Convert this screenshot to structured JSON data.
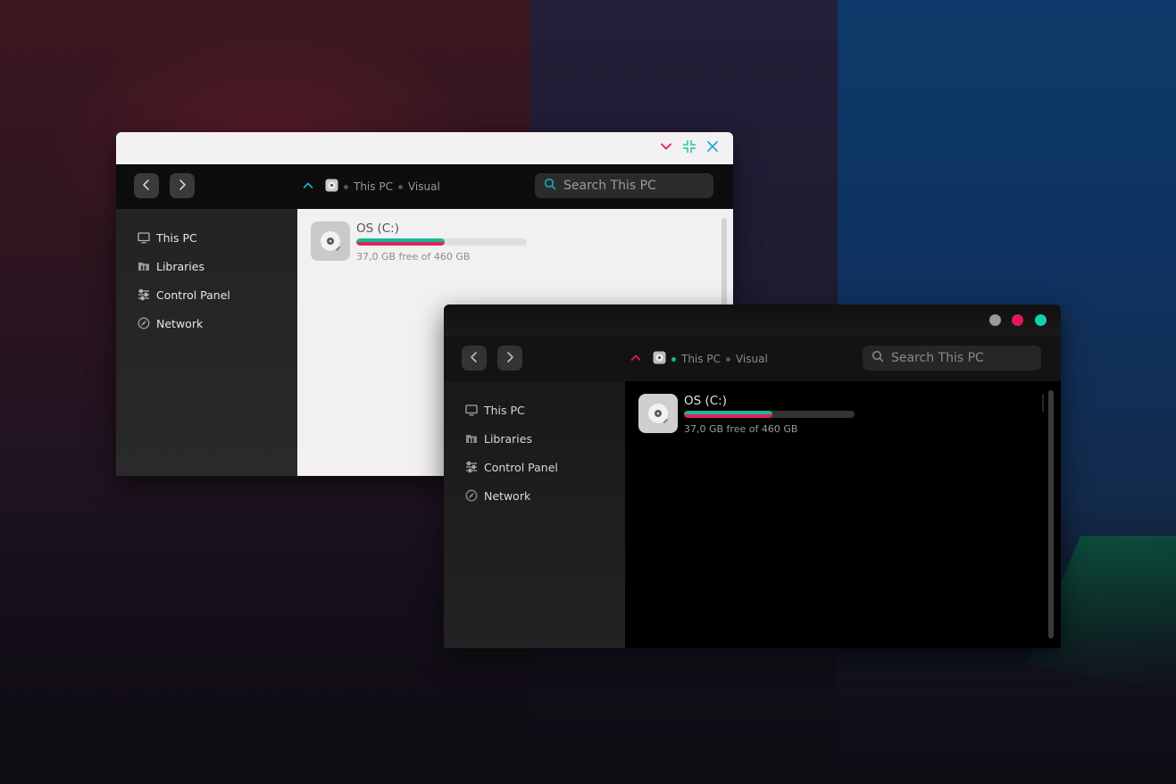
{
  "colors": {
    "accent_pink": "#e2185c",
    "accent_teal": "#14c8a8",
    "drive_fill_gradient": [
      "#14b99a",
      "#e0245e"
    ],
    "dot_gray": "#9b9b9b",
    "dot_pink": "#e2185c",
    "dot_teal": "#15d0a8"
  },
  "light_window": {
    "titlebar": {
      "buttons": [
        {
          "name": "minimize",
          "icon": "chevron-down-icon"
        },
        {
          "name": "restore",
          "icon": "compress-icon"
        },
        {
          "name": "close",
          "icon": "close-icon"
        }
      ]
    },
    "toolbar": {
      "back_icon": "chevron-left-icon",
      "forward_icon": "chevron-right-icon",
      "up_icon": "chevron-up-icon",
      "breadcrumb": [
        "This PC",
        "Visual"
      ],
      "search_placeholder": "Search This PC"
    },
    "sidebar": {
      "items": [
        {
          "label": "This PC",
          "icon": "monitor-icon"
        },
        {
          "label": "Libraries",
          "icon": "folder-icon"
        },
        {
          "label": "Control Panel",
          "icon": "sliders-icon"
        },
        {
          "label": "Network",
          "icon": "network-icon"
        }
      ]
    },
    "drive": {
      "name": "OS (C:)",
      "free_text": "37,0 GB free of 460 GB",
      "used_fraction": 0.52
    }
  },
  "dark_window": {
    "titlebar": {
      "buttons": [
        {
          "name": "minimize",
          "icon": "gray-dot-icon"
        },
        {
          "name": "maximize",
          "icon": "pink-dot-icon"
        },
        {
          "name": "close",
          "icon": "teal-dot-icon"
        }
      ]
    },
    "toolbar": {
      "back_icon": "chevron-left-icon",
      "forward_icon": "chevron-right-icon",
      "up_icon": "chevron-up-icon",
      "breadcrumb": [
        "This PC",
        "Visual"
      ],
      "search_placeholder": "Search This PC"
    },
    "sidebar": {
      "items": [
        {
          "label": "This PC",
          "icon": "monitor-icon"
        },
        {
          "label": "Libraries",
          "icon": "folder-icon"
        },
        {
          "label": "Control Panel",
          "icon": "sliders-icon"
        },
        {
          "label": "Network",
          "icon": "network-icon"
        }
      ]
    },
    "drive": {
      "name": "OS (C:)",
      "free_text": "37,0 GB free of 460 GB",
      "used_fraction": 0.52
    }
  }
}
